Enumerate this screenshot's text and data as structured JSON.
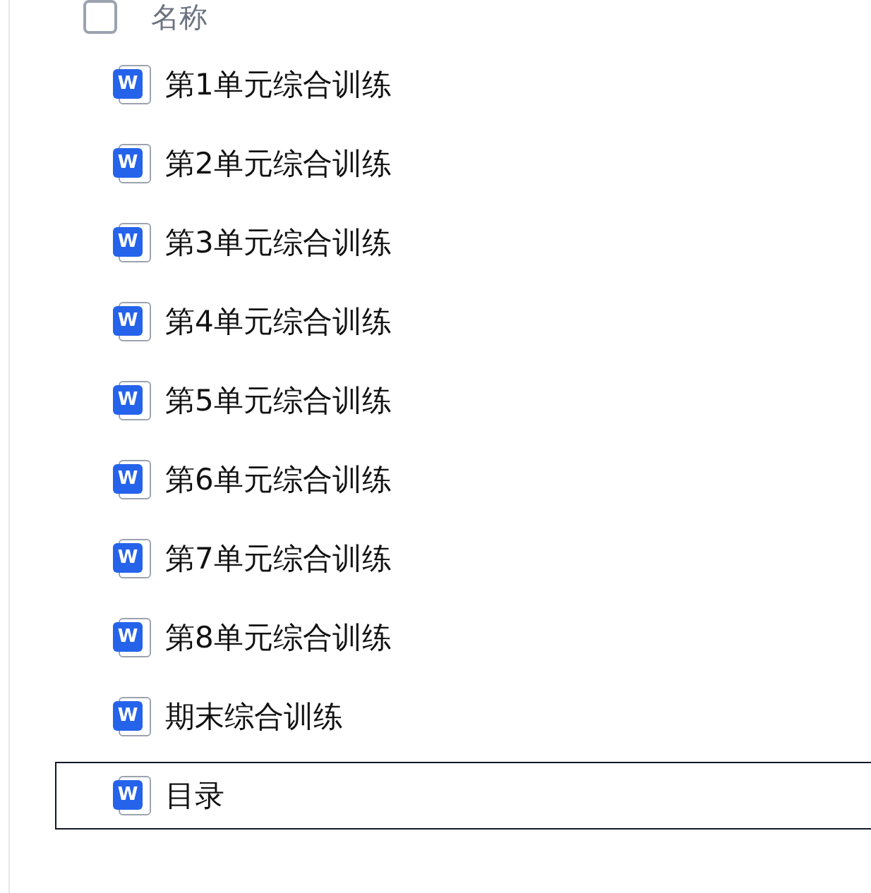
{
  "header": {
    "label": "名称",
    "checked": false
  },
  "files": [
    {
      "name": "第1单元综合训练",
      "icon_label": "W",
      "selected": false
    },
    {
      "name": "第2单元综合训练",
      "icon_label": "W",
      "selected": false
    },
    {
      "name": "第3单元综合训练",
      "icon_label": "W",
      "selected": false
    },
    {
      "name": "第4单元综合训练",
      "icon_label": "W",
      "selected": false
    },
    {
      "name": "第5单元综合训练",
      "icon_label": "W",
      "selected": false
    },
    {
      "name": "第6单元综合训练",
      "icon_label": "W",
      "selected": false
    },
    {
      "name": "第7单元综合训练",
      "icon_label": "W",
      "selected": false
    },
    {
      "name": "第8单元综合训练",
      "icon_label": "W",
      "selected": false
    },
    {
      "name": "期末综合训练",
      "icon_label": "W",
      "selected": false
    },
    {
      "name": "目录",
      "icon_label": "W",
      "selected": true
    }
  ]
}
